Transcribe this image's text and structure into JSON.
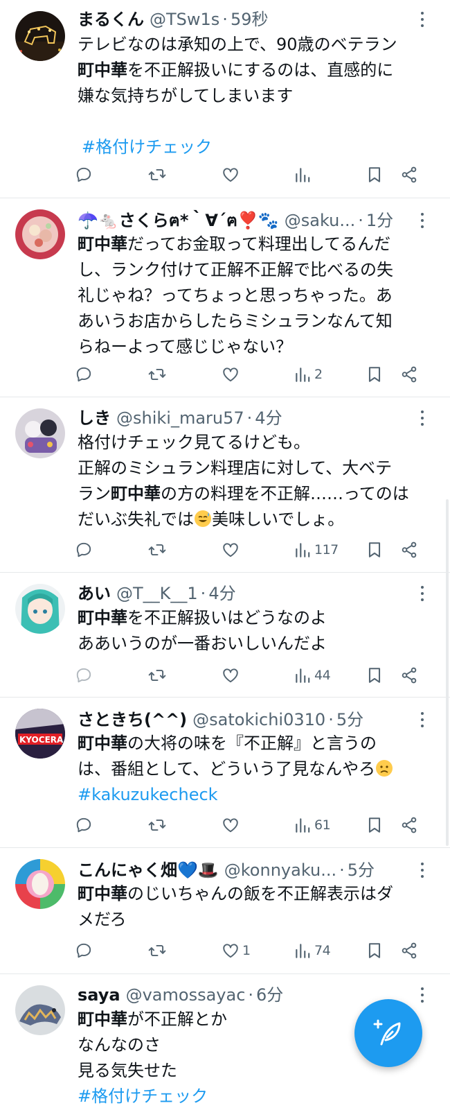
{
  "colors": {
    "accent": "#1d9bf0",
    "secondary_text": "#536471",
    "divider": "#e6e8ea"
  },
  "icons": {
    "reply": "speech-bubble-icon",
    "retweet": "retweet-icon",
    "like": "heart-icon",
    "views": "bar-chart-icon",
    "bookmark": "bookmark-icon",
    "share": "share-icon",
    "more": "more-vertical-icon",
    "compose": "compose-feather-icon"
  },
  "tweets": [
    {
      "name": "まるくん",
      "handle": "@TSw1s",
      "sep": "·",
      "time": "59秒",
      "text_1": "テレビなのは承知の上で、90歳のベテラン",
      "bold_1": "町中華",
      "text_2": "を不正解扱いにするのは、直感的に",
      "text_3": "嫌な気持ちがしてしまいます",
      "hashtag": "#格付けチェック",
      "likes": "",
      "views": ""
    },
    {
      "name": "☂️🐁さくらฅ*｀∀´ฅ❣️🐾",
      "handle": "@saku...",
      "sep": "·",
      "time": "1分",
      "bold_1": "町中華",
      "text_1": "だってお金取って料理出してるんだ",
      "text_2": "し、ランク付けて正解不正解で比べるの失",
      "text_3": "礼じゃね？ってちょっと思っちゃった。あ",
      "text_4": "あいうお店からしたらミシュランなんて知",
      "text_5": "らねーよって感じじゃない？",
      "likes": "",
      "views": "2"
    },
    {
      "name": "しき",
      "handle": "@shiki_maru57",
      "sep": "·",
      "time": "4分",
      "text_1": "格付けチェック見てるけども。",
      "text_2": "正解のミシュラン料理店に対して、大ベテ",
      "text_3a": "ラン",
      "bold_1": "町中華",
      "text_3b": "の方の料理を不正解……ってのは",
      "text_4a": "だいぶ失礼では",
      "text_4b": "美味しいでしょ。",
      "emoji_1": "sweat-smile-emoji",
      "likes": "",
      "views": "117"
    },
    {
      "name": "あい",
      "handle": "@T__K__1",
      "sep": "·",
      "time": "4分",
      "bold_1": "町中華",
      "text_1": "を不正解扱いはどうなのよ",
      "text_2": "ああいうのが一番おいしいんだよ",
      "likes": "",
      "views": "44"
    },
    {
      "name": "さときち(^^)",
      "handle": "@satokichi0310",
      "sep": "·",
      "time": "5分",
      "bold_1": "町中華",
      "text_1": "の大将の味を『不正解』と言うの",
      "text_2": "は、番組として、どういう了見なんやろ",
      "emoji_1": "worried-face-emoji",
      "hashtag": "#kakuzukecheck",
      "likes": "",
      "views": "61"
    },
    {
      "name": "こんにゃく畑💙🎩",
      "handle": "@konnyaku...",
      "sep": "·",
      "time": "5分",
      "bold_1": "町中華",
      "text_1": "のじいちゃんの飯を不正解表示はダ",
      "text_2": "メだろ",
      "likes": "1",
      "views": "74"
    },
    {
      "name": "saya",
      "handle": "@vamossayac",
      "sep": "·",
      "time": "6分",
      "bold_1": "町中華",
      "text_1": "が不正解とか",
      "text_2": "なんなのさ",
      "text_3": "見る気失せた",
      "hashtag": "#格付けチェック"
    }
  ]
}
